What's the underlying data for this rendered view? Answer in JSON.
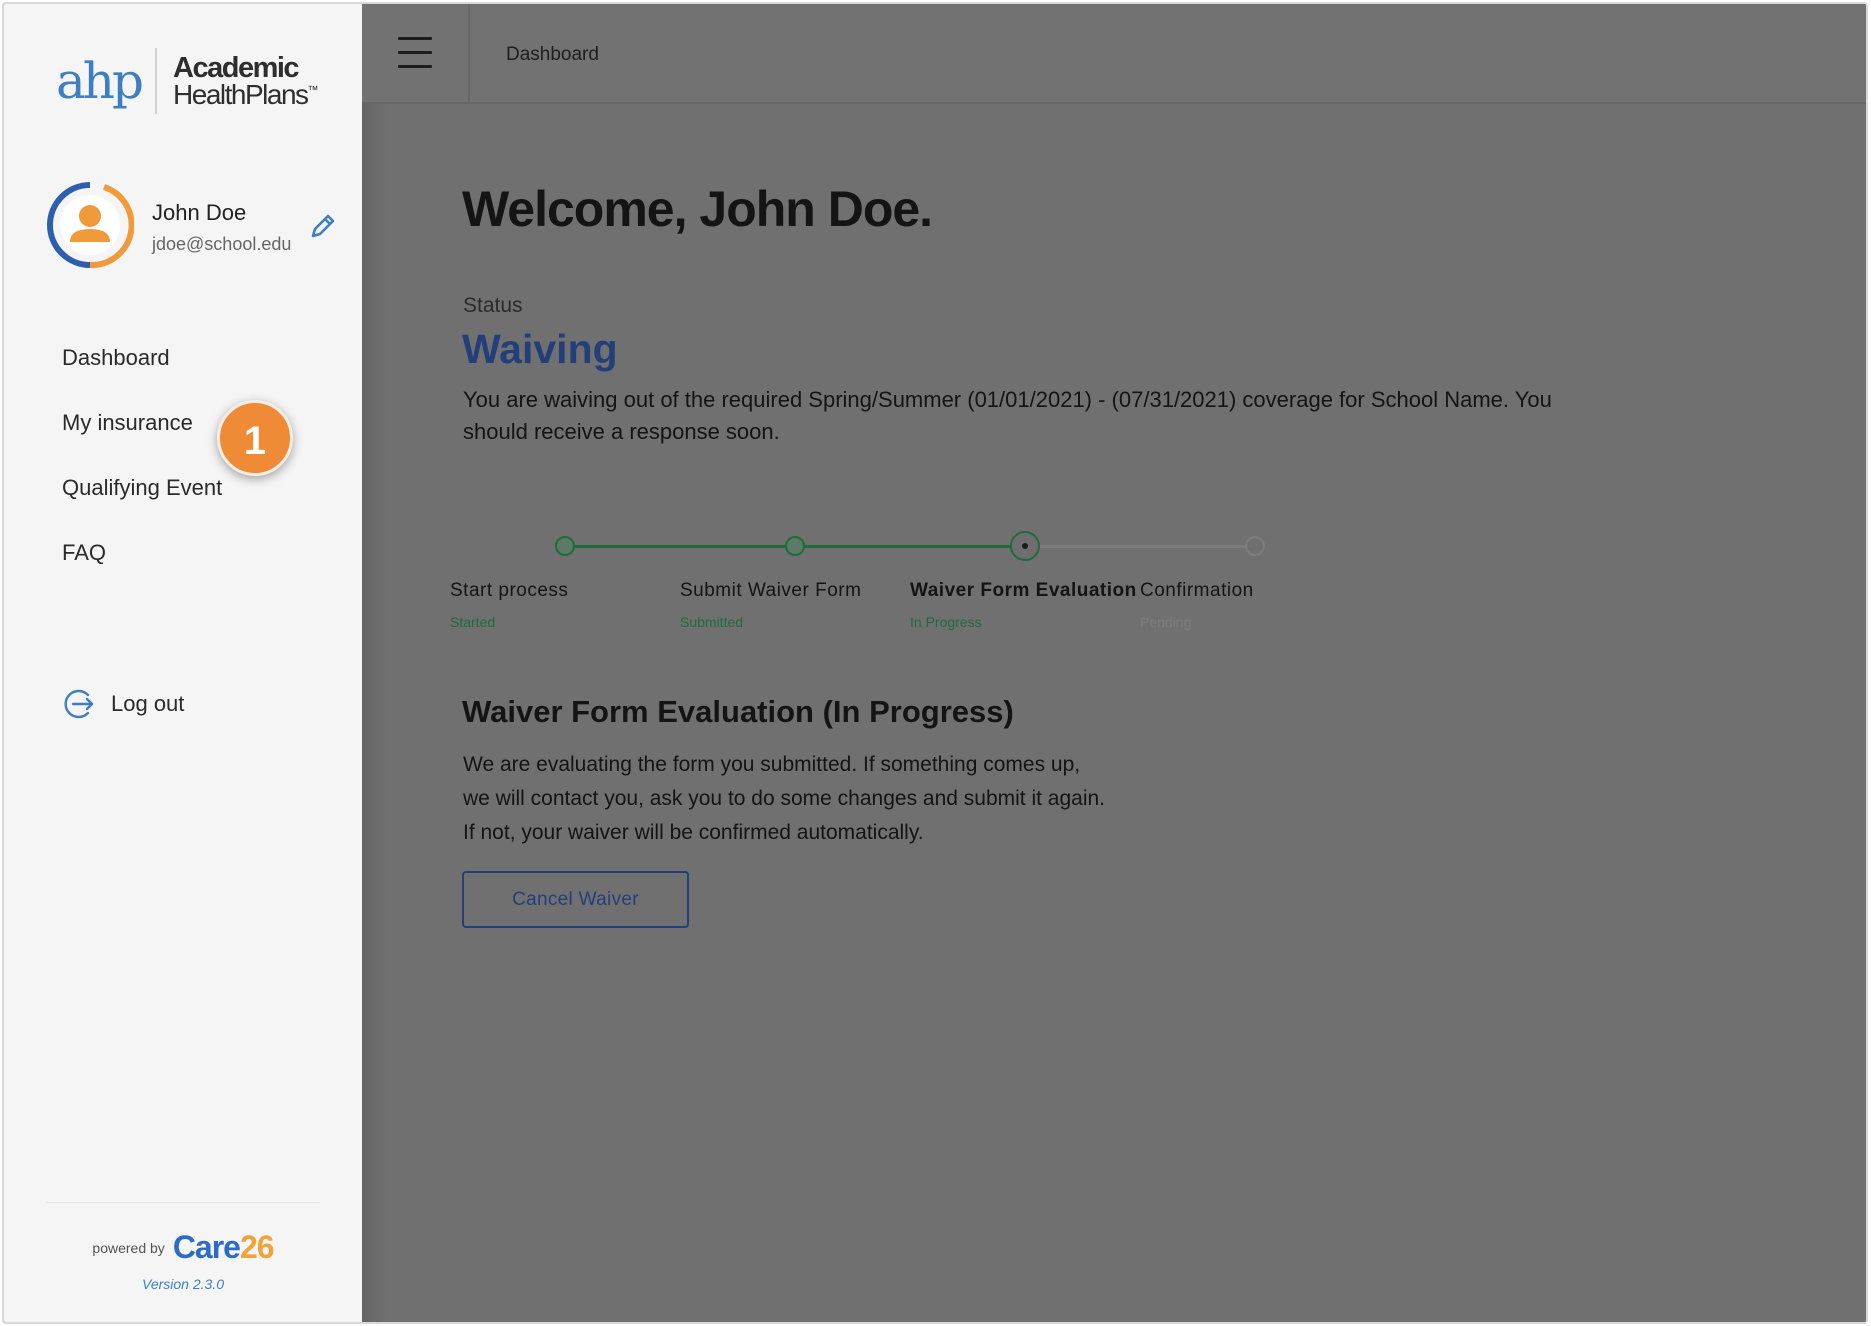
{
  "brand": {
    "logo_mark": "ahp",
    "logo_line1": "Academic",
    "logo_line2": "HealthPlans",
    "logo_tm": "™"
  },
  "user": {
    "name": "John Doe",
    "email": "jdoe@school.edu"
  },
  "sidebar": {
    "items": [
      {
        "label": "Dashboard"
      },
      {
        "label": "My insurance"
      },
      {
        "label": "Qualifying Event"
      },
      {
        "label": "FAQ"
      }
    ],
    "callout_badge": "1",
    "logout_label": "Log out",
    "footer": {
      "powered_by": "powered by",
      "brand_part1": "Care",
      "brand_part2": "26",
      "version": "Version 2.3.0"
    }
  },
  "header": {
    "title": "Dashboard"
  },
  "main": {
    "welcome": "Welcome, John Doe.",
    "status_label": "Status",
    "status_value": "Waiving",
    "status_description": "You are waiving out of the required Spring/Summer (01/01/2021) - (07/31/2021) coverage for School Name. You should receive a response soon.",
    "steps": [
      {
        "label": "Start process",
        "status": "Started",
        "state": "done"
      },
      {
        "label": "Submit Waiver Form",
        "status": "Submitted",
        "state": "done"
      },
      {
        "label": "Waiver Form Evaluation",
        "status": "In Progress",
        "state": "current"
      },
      {
        "label": "Confirmation",
        "status": "Pending",
        "state": "pending"
      }
    ],
    "evaluation_title": "Waiver Form Evaluation (In Progress)",
    "evaluation_lines": [
      "We are evaluating the form you submitted. If something comes up,",
      "we will contact you, ask you to do some changes and submit it again.",
      "If not, your waiver will be confirmed automatically."
    ],
    "cancel_button": "Cancel Waiver"
  },
  "colors": {
    "accent_blue": "#233f7a",
    "step_green": "#1f6b3e",
    "step_pending": "#7d7d7d",
    "badge_orange": "#ef8a36",
    "overlay_gray": "#707070"
  }
}
